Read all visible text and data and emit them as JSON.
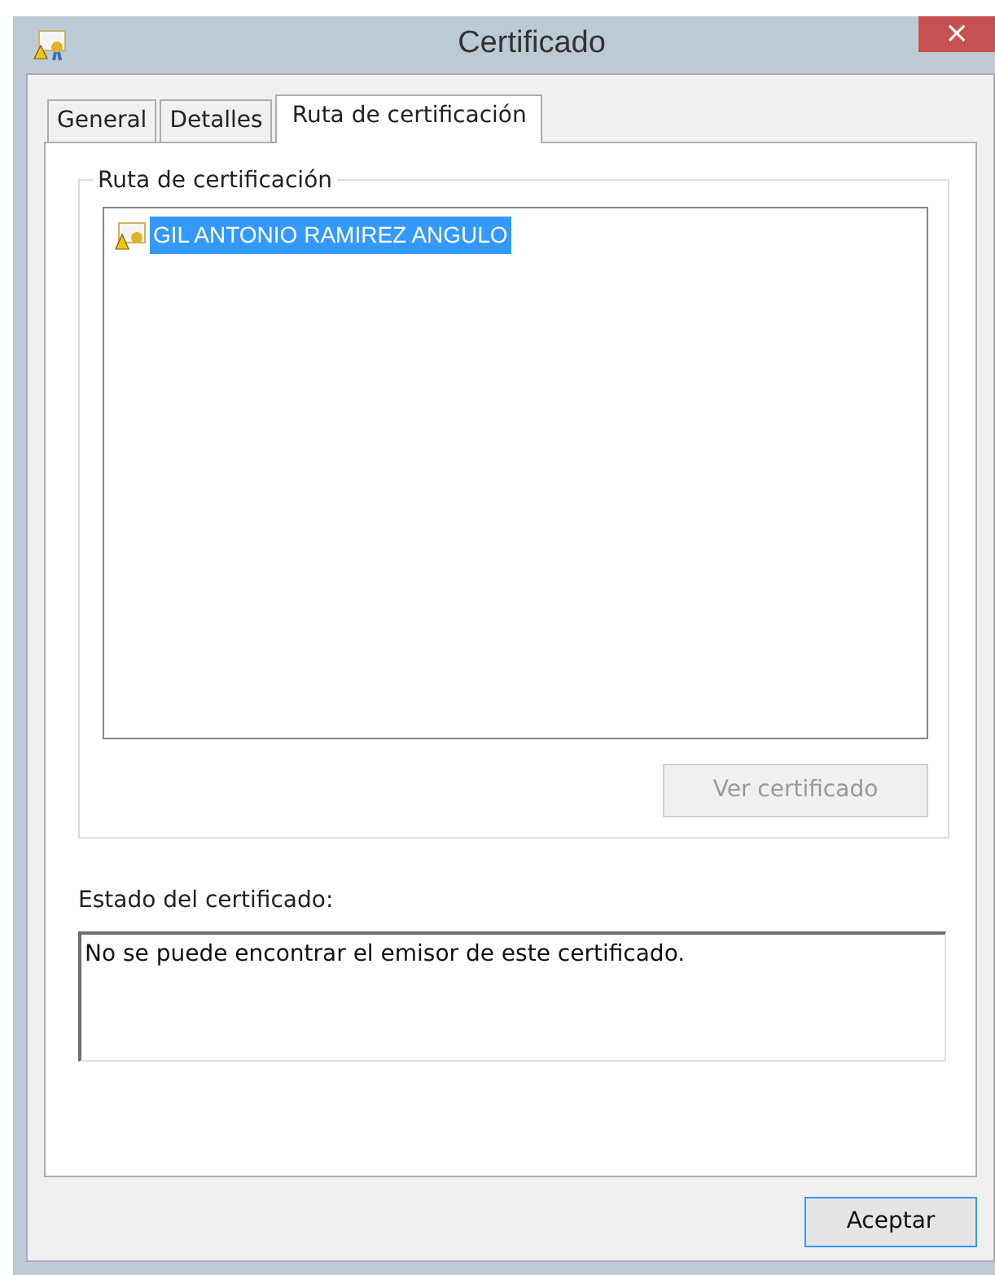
{
  "window": {
    "title": "Certificado",
    "close": "×"
  },
  "tabs": [
    {
      "label": "General",
      "selected": false
    },
    {
      "label": "Detalles",
      "selected": false
    },
    {
      "label": "Ruta de certificación",
      "selected": true
    }
  ],
  "group": {
    "title": "Ruta de certificación",
    "tree": [
      {
        "label": "GIL ANTONIO RAMIREZ ANGULO",
        "selected": true
      }
    ],
    "button": {
      "label": "Ver certificado",
      "disabled": true
    }
  },
  "status": {
    "label": "Estado del certificado:",
    "value": "No se puede encontrar el emisor de este certificado."
  },
  "buttons": [
    {
      "label": "Aceptar",
      "default": true
    }
  ]
}
